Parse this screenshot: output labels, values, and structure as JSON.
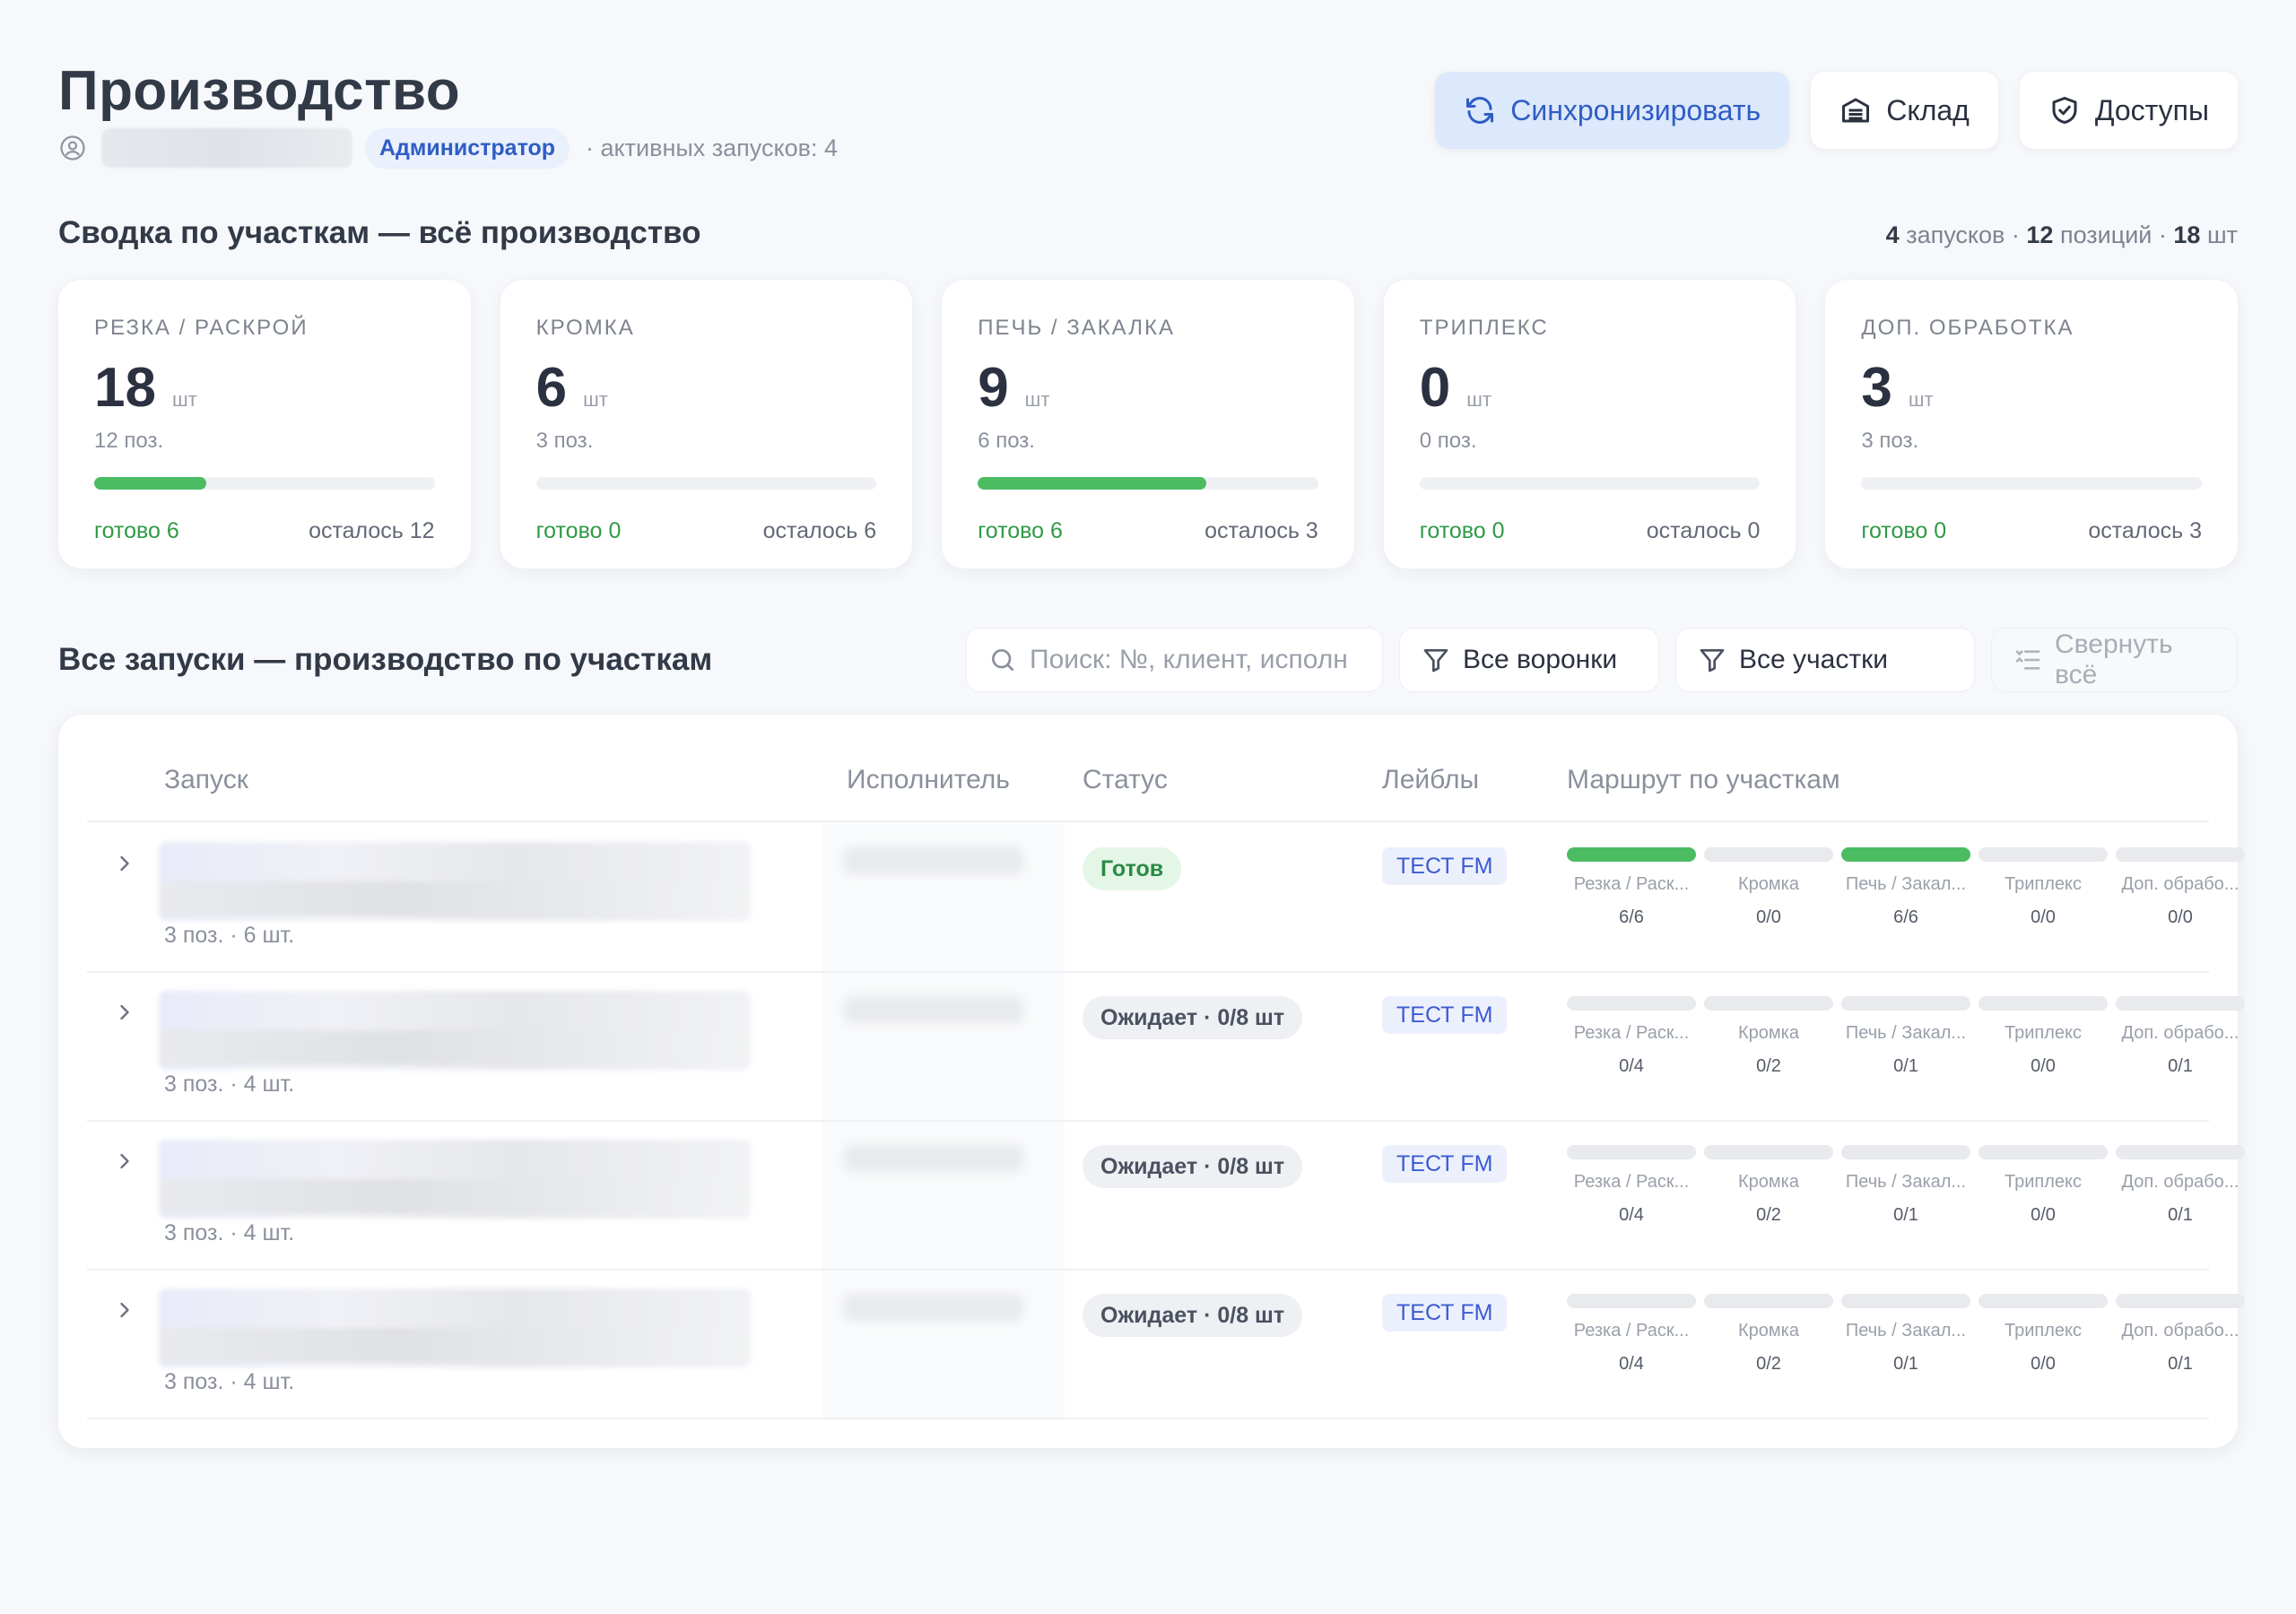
{
  "header": {
    "title": "Производство",
    "role": "Администратор",
    "active_runs": "· активных запусков: 4",
    "buttons": {
      "sync": "Синхронизировать",
      "stock": "Склад",
      "access": "Доступы"
    }
  },
  "summary": {
    "title": "Сводка по участкам — всё производство",
    "stats": {
      "runs_num": "4",
      "runs_label": "запусков ·",
      "positions_num": "12",
      "positions_label": "позиций ·",
      "pieces_num": "18",
      "pieces_label": "шт"
    },
    "cards": [
      {
        "title": "РЕЗКА / РАСКРОЙ",
        "count": "18",
        "unit": "шт",
        "positions": "12 поз.",
        "progress": 0.33,
        "ready": "готово 6",
        "left": "осталось 12"
      },
      {
        "title": "КРОМКА",
        "count": "6",
        "unit": "шт",
        "positions": "3 поз.",
        "progress": 0,
        "ready": "готово 0",
        "left": "осталось 6"
      },
      {
        "title": "ПЕЧЬ / ЗАКАЛКА",
        "count": "9",
        "unit": "шт",
        "positions": "6 поз.",
        "progress": 0.67,
        "ready": "готово 6",
        "left": "осталось 3"
      },
      {
        "title": "ТРИПЛЕКС",
        "count": "0",
        "unit": "шт",
        "positions": "0 поз.",
        "progress": 0,
        "ready": "готово 0",
        "left": "осталось 0"
      },
      {
        "title": "ДОП. ОБРАБОТКА",
        "count": "3",
        "unit": "шт",
        "positions": "3 поз.",
        "progress": 0,
        "ready": "готово 0",
        "left": "осталось 3"
      }
    ]
  },
  "runs": {
    "title": "Все запуски — производство по участкам",
    "search_placeholder": "Поиск: №, клиент, исполн",
    "filter_funnels": "Все воронки",
    "filter_sections": "Все участки",
    "collapse_all": "Свернуть всё",
    "columns": {
      "run": "Запуск",
      "executor": "Исполнитель",
      "status": "Статус",
      "labels": "Лейблы",
      "route": "Маршрут по участкам"
    },
    "route_names": [
      "Резка / Раск...",
      "Кромка",
      "Печь / Закал...",
      "Триплекс",
      "Доп. обрабо..."
    ],
    "rows": [
      {
        "meta": "3 поз. · 6 шт.",
        "status": "Готов",
        "status_type": "done",
        "label": "ТЕСТ FM",
        "route": [
          {
            "value": "6/6",
            "full": true
          },
          {
            "value": "0/0",
            "full": false
          },
          {
            "value": "6/6",
            "full": true
          },
          {
            "value": "0/0",
            "full": false
          },
          {
            "value": "0/0",
            "full": false
          }
        ]
      },
      {
        "meta": "3 поз. · 4 шт.",
        "status": "Ожидает · 0/8 шт",
        "status_type": "wait",
        "label": "ТЕСТ FM",
        "route": [
          {
            "value": "0/4",
            "full": false
          },
          {
            "value": "0/2",
            "full": false
          },
          {
            "value": "0/1",
            "full": false
          },
          {
            "value": "0/0",
            "full": false
          },
          {
            "value": "0/1",
            "full": false
          }
        ]
      },
      {
        "meta": "3 поз. · 4 шт.",
        "status": "Ожидает · 0/8 шт",
        "status_type": "wait",
        "label": "ТЕСТ FM",
        "route": [
          {
            "value": "0/4",
            "full": false
          },
          {
            "value": "0/2",
            "full": false
          },
          {
            "value": "0/1",
            "full": false
          },
          {
            "value": "0/0",
            "full": false
          },
          {
            "value": "0/1",
            "full": false
          }
        ]
      },
      {
        "meta": "3 поз. · 4 шт.",
        "status": "Ожидает · 0/8 шт",
        "status_type": "wait",
        "label": "ТЕСТ FM",
        "route": [
          {
            "value": "0/4",
            "full": false
          },
          {
            "value": "0/2",
            "full": false
          },
          {
            "value": "0/1",
            "full": false
          },
          {
            "value": "0/0",
            "full": false
          },
          {
            "value": "0/1",
            "full": false
          }
        ]
      }
    ]
  },
  "colors": {
    "accent": "#2f5dc5",
    "success": "#4cbc63",
    "background": "#f6f8fb"
  }
}
